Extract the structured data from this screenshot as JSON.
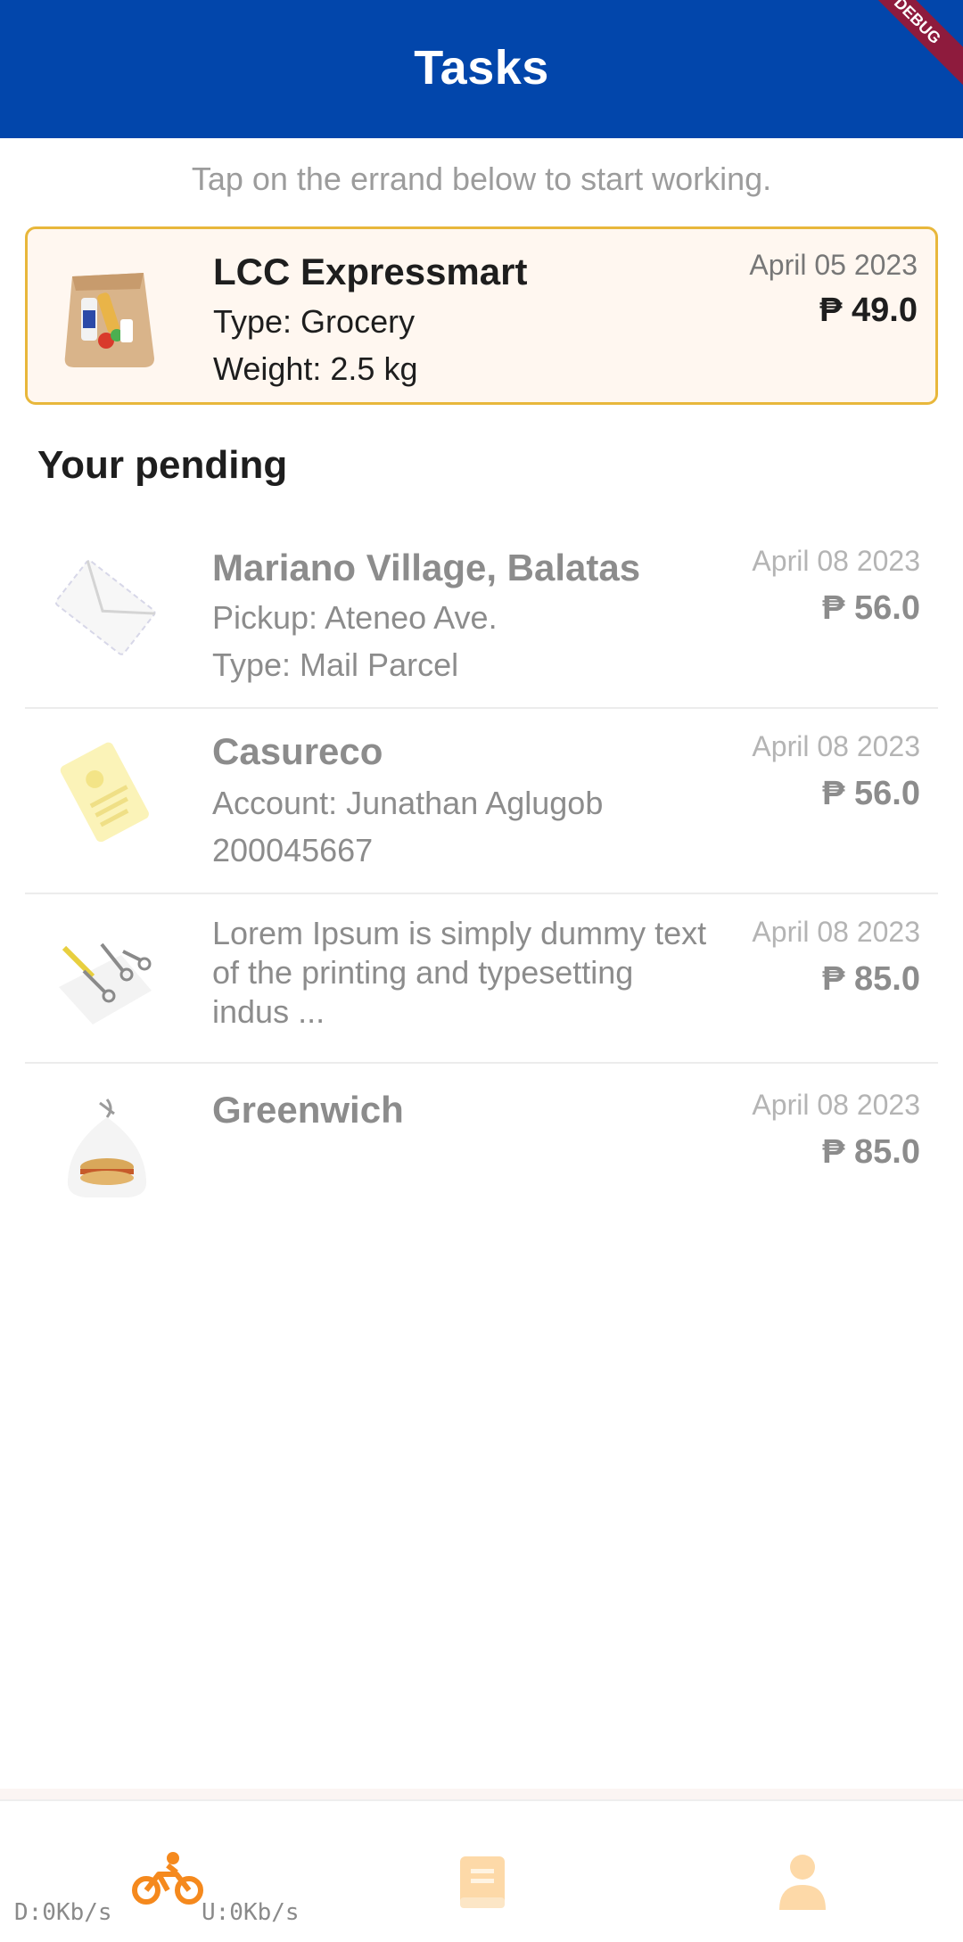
{
  "header": {
    "title": "Tasks",
    "debug_banner": "DEBUG"
  },
  "hint": "Tap on the errand below to start working.",
  "active": {
    "title": "LCC Expressmart",
    "line1": "Type: Grocery",
    "line2": "Weight: 2.5 kg",
    "date": "April 05 2023",
    "price": "₱ 49.0",
    "icon": "grocery-bag-icon"
  },
  "pending_title": "Your pending",
  "pending": [
    {
      "title": "Mariano Village, Balatas",
      "line1": "Pickup: Ateneo Ave.",
      "line2": "Type: Mail Parcel",
      "date": "April 08 2023",
      "price": "₱ 56.0",
      "icon": "envelope-icon"
    },
    {
      "title": "Casureco",
      "line1": "Account: Junathan Aglugob",
      "line2": "200045667",
      "date": "April 08 2023",
      "price": "₱ 56.0",
      "icon": "bill-icon"
    },
    {
      "description": "Lorem Ipsum is simply dummy text of the printing and typesetting indus ...",
      "date": "April 08 2023",
      "price": "₱ 85.0",
      "icon": "tools-icon"
    },
    {
      "title": "Greenwich",
      "date": "April 08 2023",
      "price": "₱ 85.0",
      "icon": "food-takeout-icon"
    }
  ],
  "nav": {
    "items": [
      "bike-icon",
      "book-icon",
      "person-icon"
    ],
    "active": "bike-icon"
  },
  "netspeed": {
    "down": "D:0Kb/s",
    "up": "U:0Kb/s"
  },
  "colors": {
    "header": "#0246ab",
    "accent": "#f5891d",
    "card_border": "#e8b73b",
    "card_bg": "#fff7f0"
  }
}
